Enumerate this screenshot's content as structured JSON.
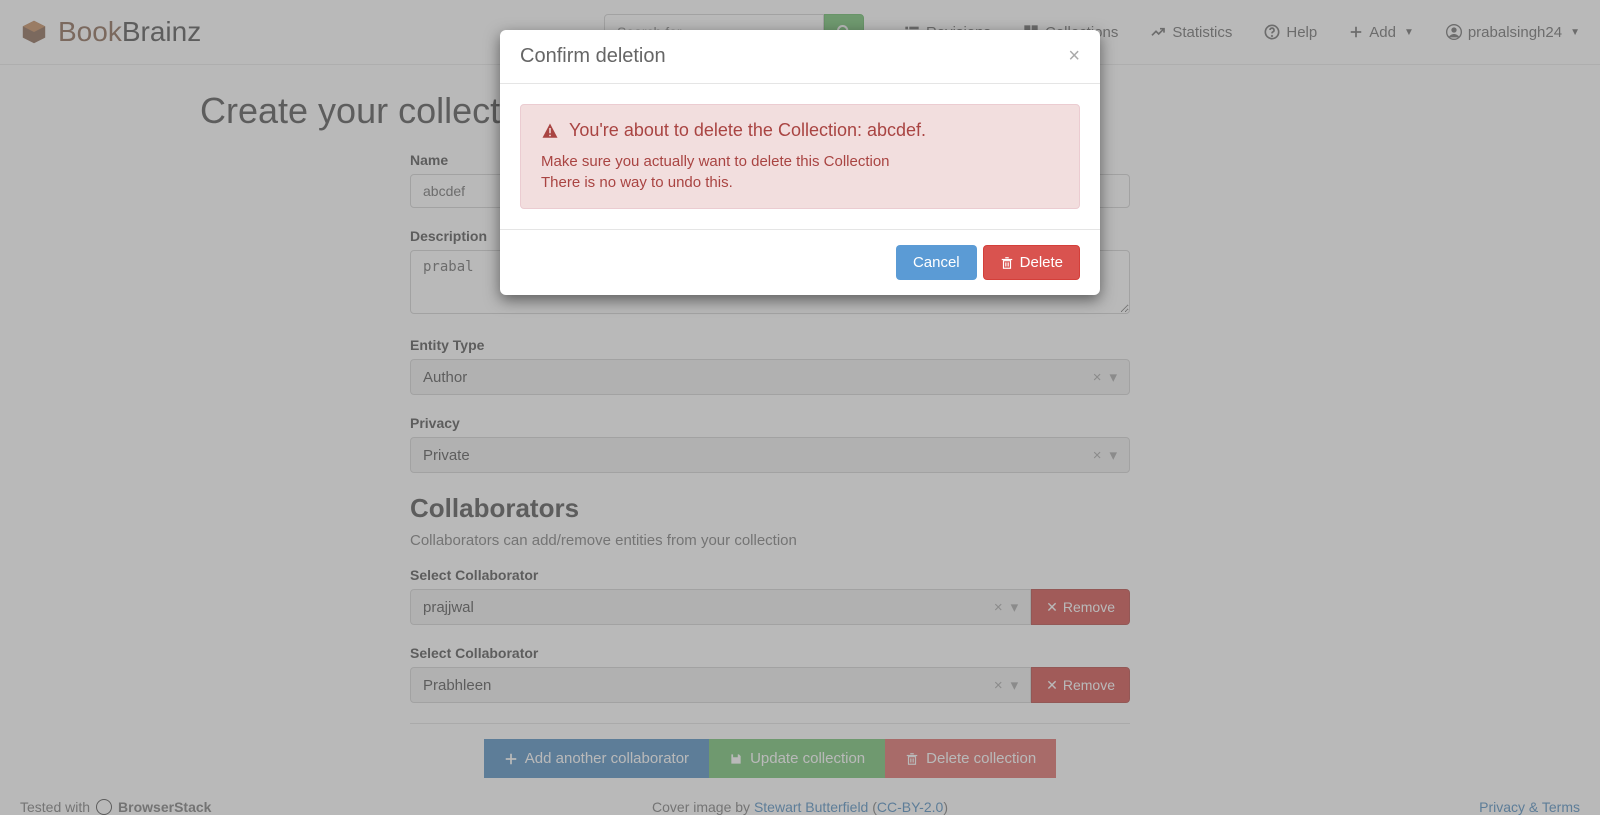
{
  "brand": {
    "book": "Book",
    "brainz": "Brainz"
  },
  "search": {
    "placeholder": "Search for..."
  },
  "nav": {
    "revisions": "Revisions",
    "collections": "Collections",
    "statistics": "Statistics",
    "help": "Help",
    "add": "Add",
    "user": "prabalsingh24"
  },
  "page": {
    "title": "Create your collection",
    "name_label": "Name",
    "name_value": "abcdef",
    "description_label": "Description",
    "description_value": "prabal",
    "entity_type_label": "Entity Type",
    "entity_type_value": "Author",
    "privacy_label": "Privacy",
    "privacy_value": "Private",
    "collaborators_title": "Collaborators",
    "collaborators_subtitle": "Collaborators can add/remove entities from your collection",
    "select_collaborator_label": "Select Collaborator",
    "collaborators": [
      {
        "name": "prajjwal"
      },
      {
        "name": "Prabhleen"
      }
    ],
    "remove_label": "Remove",
    "add_collab_label": "Add another collaborator",
    "update_label": "Update collection",
    "delete_label": "Delete collection"
  },
  "footer": {
    "tested_with": "Tested with",
    "browserstack": "BrowserStack",
    "cover_prefix": "Cover image by ",
    "cover_author": "Stewart Butterfield",
    "cover_license_open": " (",
    "cover_license": "CC-BY-2.0",
    "cover_license_close": ")",
    "privacy": "Privacy & Terms"
  },
  "modal": {
    "title": "Confirm deletion",
    "warning_heading": "You're about to delete the Collection: abcdef.",
    "warning_line1": "Make sure you actually want to delete this Collection",
    "warning_line2": "There is no way to undo this.",
    "cancel": "Cancel",
    "delete": "Delete"
  }
}
